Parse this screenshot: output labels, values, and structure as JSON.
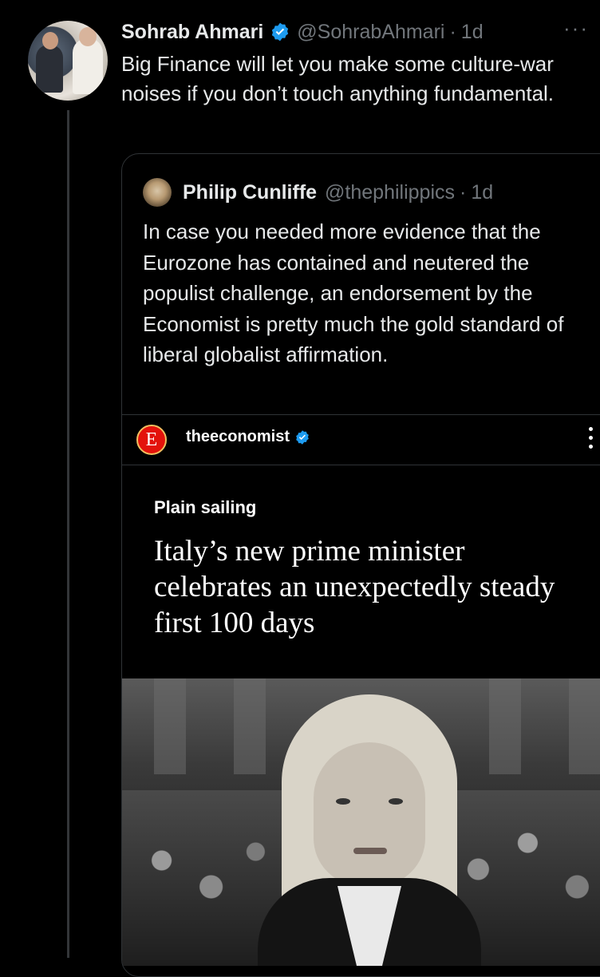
{
  "tweet": {
    "author_name": "Sohrab Ahmari",
    "handle": "@SohrabAhmari",
    "separator": "·",
    "time": "1d",
    "more": "···",
    "text": "Big Finance will let you make some culture-war noises if you don’t touch anything fundamental."
  },
  "quoted_tweet": {
    "author_name": "Philip Cunliffe",
    "handle": "@thephilippics",
    "separator": "·",
    "time": "1d",
    "text": "In case you needed more evidence that the Eurozone has contained and neutered the populist challenge, an endorsement by the Economist is pretty much the gold standard of liberal globalist affirmation."
  },
  "embedded_post": {
    "account": "theeconomist",
    "logo_letter": "E",
    "kicker": "Plain sailing",
    "headline": "Italy’s new prime minister celebrates an unexpectedly steady first 100 days"
  },
  "colors": {
    "background": "#000000",
    "text": "#e7e9ea",
    "muted": "#71767b",
    "verified": "#1d9bf0",
    "economist_red": "#e3120b"
  }
}
